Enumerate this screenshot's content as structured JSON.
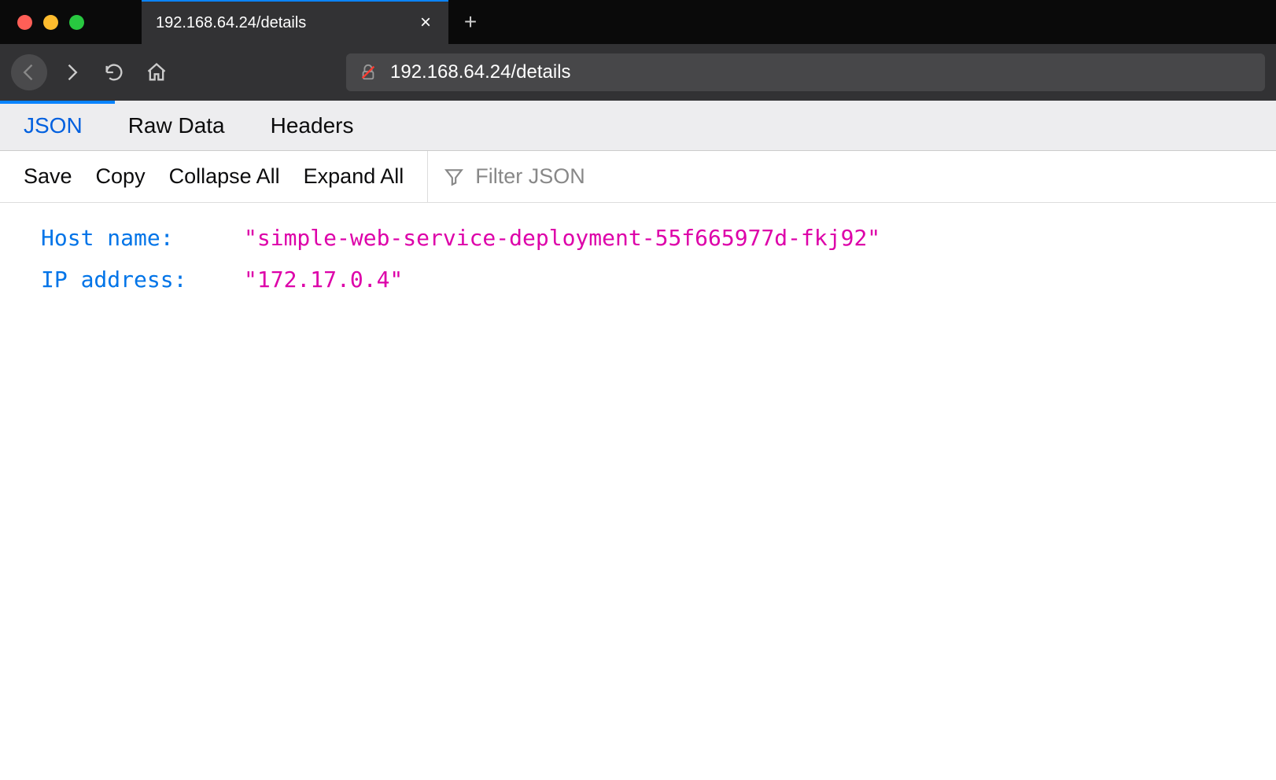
{
  "browser": {
    "tab_title": "192.168.64.24/details",
    "url": "192.168.64.24/details"
  },
  "view_tabs": {
    "json": "JSON",
    "raw_data": "Raw Data",
    "headers": "Headers"
  },
  "toolbar": {
    "save": "Save",
    "copy": "Copy",
    "collapse_all": "Collapse All",
    "expand_all": "Expand All",
    "filter_placeholder": "Filter JSON"
  },
  "json_data": [
    {
      "key": "Host name:",
      "value": "\"simple-web-service-deployment-55f665977d-fkj92\""
    },
    {
      "key": "IP address:",
      "value": "\"172.17.0.4\""
    }
  ]
}
